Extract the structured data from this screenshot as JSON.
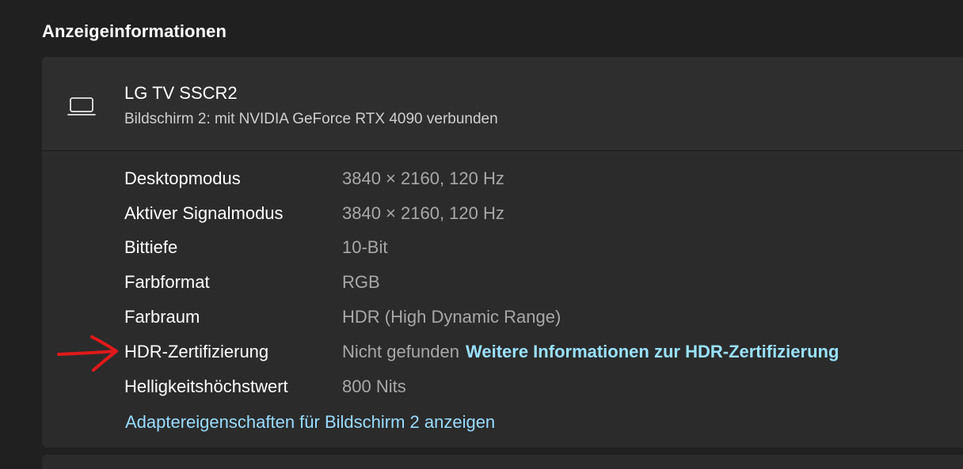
{
  "section": {
    "title": "Anzeigeinformationen"
  },
  "display": {
    "icon": "laptop-icon",
    "name": "LG TV SSCR2",
    "subtitle": "Bildschirm 2: mit NVIDIA GeForce RTX 4090 verbunden"
  },
  "properties": [
    {
      "label": "Desktopmodus",
      "value": "3840 × 2160, 120 Hz"
    },
    {
      "label": "Aktiver Signalmodus",
      "value": "3840 × 2160, 120 Hz"
    },
    {
      "label": "Bittiefe",
      "value": "10-Bit"
    },
    {
      "label": "Farbformat",
      "value": "RGB"
    },
    {
      "label": "Farbraum",
      "value": "HDR (High Dynamic Range)"
    },
    {
      "label": "HDR-Zertifizierung",
      "value": "Nicht gefunden",
      "link": "Weitere Informationen zur HDR-Zertifizierung"
    },
    {
      "label": "Helligkeitshöchstwert",
      "value": "800 Nits"
    }
  ],
  "adapter_link": "Adaptereigenschaften für Bildschirm 2 anzeigen",
  "annotation": {
    "icon": "red-arrow-annotation",
    "color": "#e0191b"
  },
  "colors": {
    "background": "#202020",
    "card": "#2b2b2b",
    "link": "#99e1ff"
  }
}
